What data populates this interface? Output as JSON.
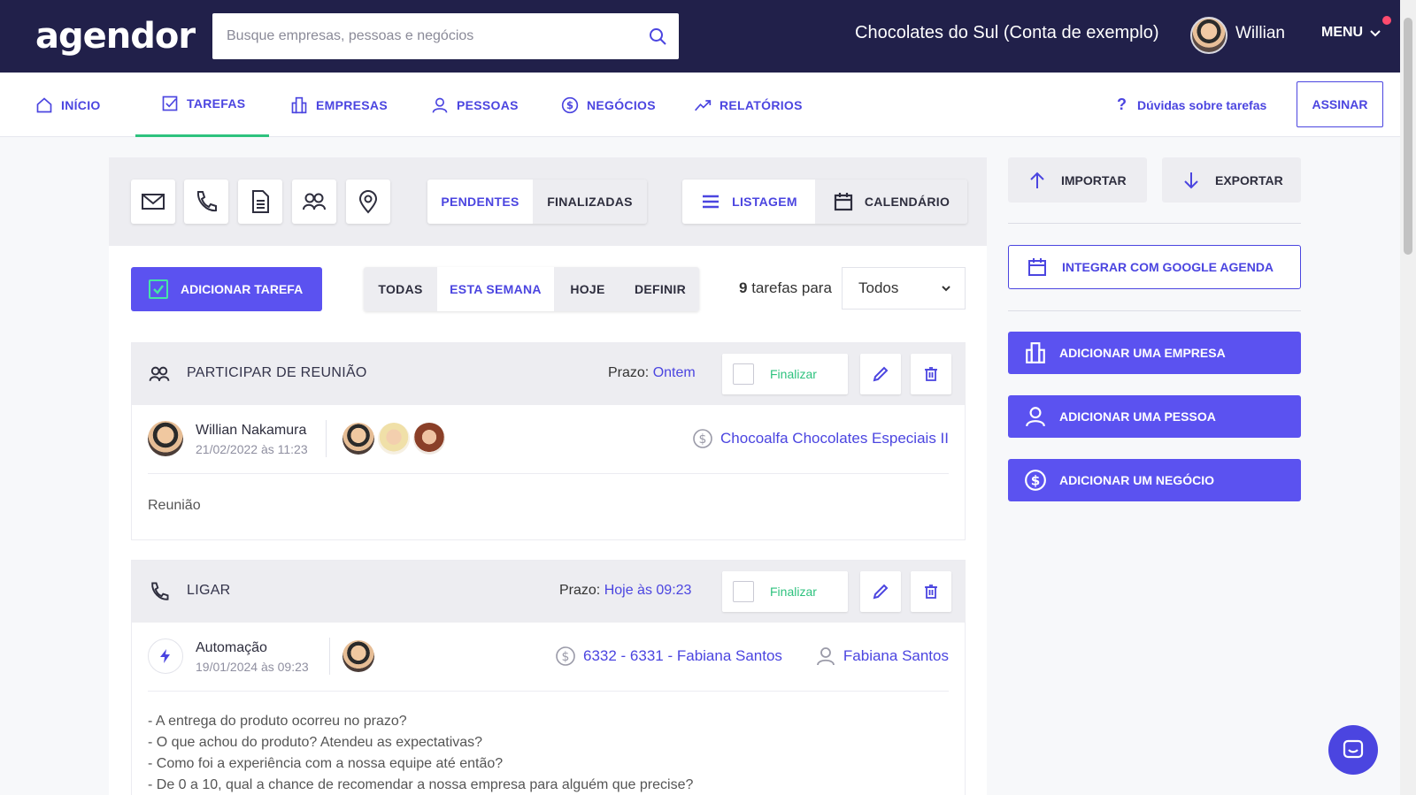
{
  "topbar": {
    "logo": "agendor",
    "search_placeholder": "Busque empresas, pessoas e negócios",
    "account": "Chocolates do Sul (Conta de exemplo)",
    "user": "Willian",
    "menu": "MENU"
  },
  "nav": {
    "items": [
      {
        "label": "INÍCIO"
      },
      {
        "label": "TAREFAS"
      },
      {
        "label": "EMPRESAS"
      },
      {
        "label": "PESSOAS"
      },
      {
        "label": "NEGÓCIOS"
      },
      {
        "label": "RELATÓRIOS"
      }
    ],
    "help": "Dúvidas sobre tarefas",
    "subscribe": "ASSINAR"
  },
  "filters": {
    "status": [
      "PENDENTES",
      "FINALIZADAS"
    ],
    "view": [
      "LISTAGEM",
      "CALENDÁRIO"
    ],
    "period": [
      "TODAS",
      "ESTA SEMANA",
      "HOJE",
      "DEFINIR"
    ]
  },
  "toolbar": {
    "add_task": "ADICIONAR TAREFA",
    "count_number": "9",
    "count_suffix": "tarefas para",
    "owner_select": "Todos"
  },
  "tasks": [
    {
      "title": "PARTICIPAR DE REUNIÃO",
      "prazo_label": "Prazo:",
      "prazo_value": "Ontem",
      "finalize": "Finalizar",
      "author": "Willian Nakamura",
      "date": "21/02/2022 às 11:23",
      "deal": "Chocoalfa Chocolates Especiais II",
      "description": "Reunião"
    },
    {
      "title": "LIGAR",
      "prazo_label": "Prazo:",
      "prazo_value": "Hoje às 09:23",
      "finalize": "Finalizar",
      "author": "Automação",
      "date": "19/01/2024 às 09:23",
      "deal": "6332 - 6331 - Fabiana Santos",
      "person": "Fabiana Santos",
      "lines": [
        "- A entrega do produto ocorreu no prazo?",
        "- O que achou do produto? Atendeu as expectativas?",
        "- Como foi a experiência com a nossa equipe até então?",
        "- De 0 a 10, qual a chance de recomendar a nossa empresa para alguém que precise?"
      ]
    }
  ],
  "sidebar": {
    "import": "IMPORTAR",
    "export": "EXPORTAR",
    "google": "INTEGRAR COM GOOGLE AGENDA",
    "add_company": "ADICIONAR UMA EMPRESA",
    "add_person": "ADICIONAR UMA PESSOA",
    "add_deal": "ADICIONAR UM NEGÓCIO"
  },
  "colors": {
    "topbar": "#21204a",
    "primary": "#5b52f0",
    "link": "#4b45e0",
    "success": "#2ec27e",
    "notification": "#ff4b6e"
  }
}
